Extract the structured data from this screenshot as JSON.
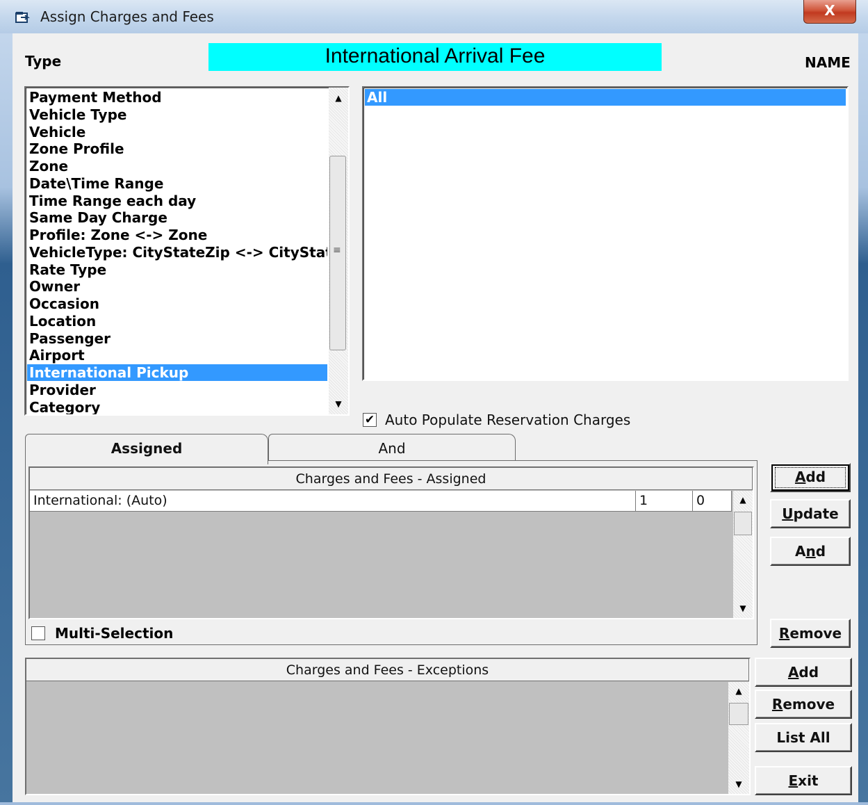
{
  "window": {
    "title": "Assign Charges and Fees",
    "close_symbol": "X"
  },
  "header": {
    "type_label": "Type",
    "fee_name": "International Arrival Fee",
    "name_label": "NAME"
  },
  "type_list": {
    "items": [
      "Payment Method",
      "Vehicle Type",
      "Vehicle",
      "Zone Profile",
      "Zone",
      "Date\\Time Range",
      "Time Range each day",
      "Same Day Charge",
      "Profile: Zone <-> Zone",
      "VehicleType: CityStateZip <-> CityStateZip",
      "Rate Type",
      "Owner",
      "Occasion",
      "Location",
      "Passenger",
      "Airport",
      "International Pickup",
      "Provider",
      "Category"
    ],
    "selected": "International Pickup"
  },
  "name_list": {
    "items": [
      "All"
    ],
    "selected": "All"
  },
  "auto_populate": {
    "label": "Auto Populate Reservation Charges",
    "checked": true
  },
  "tabs": [
    {
      "label": "Assigned",
      "active": true
    },
    {
      "label": "And",
      "active": false
    }
  ],
  "assigned_grid": {
    "header": "Charges and Fees - Assigned",
    "rows": [
      {
        "name": "International:  (Auto)",
        "col2": "1",
        "col3": "0"
      }
    ]
  },
  "multi_selection": {
    "label": "Multi-Selection",
    "checked": false
  },
  "assigned_buttons": {
    "add": {
      "pre": "",
      "u": "A",
      "post": "dd"
    },
    "update": {
      "pre": "",
      "u": "U",
      "post": "pdate"
    },
    "and": {
      "pre": "A",
      "u": "n",
      "post": "d"
    },
    "remove": {
      "pre": "",
      "u": "R",
      "post": "emove"
    }
  },
  "exceptions_grid": {
    "header": "Charges and Fees - Exceptions",
    "rows": []
  },
  "exceptions_buttons": {
    "add": {
      "pre": "",
      "u": "A",
      "post": "dd"
    },
    "remove": {
      "pre": "",
      "u": "R",
      "post": "emove"
    },
    "list_all": {
      "pre": "List All",
      "u": "",
      "post": ""
    },
    "exit": {
      "pre": "",
      "u": "E",
      "post": "xit"
    }
  },
  "colors": {
    "fee_title_bg": "#00ffff",
    "selection": "#3399ff",
    "grid_empty": "#c0c0c0"
  }
}
